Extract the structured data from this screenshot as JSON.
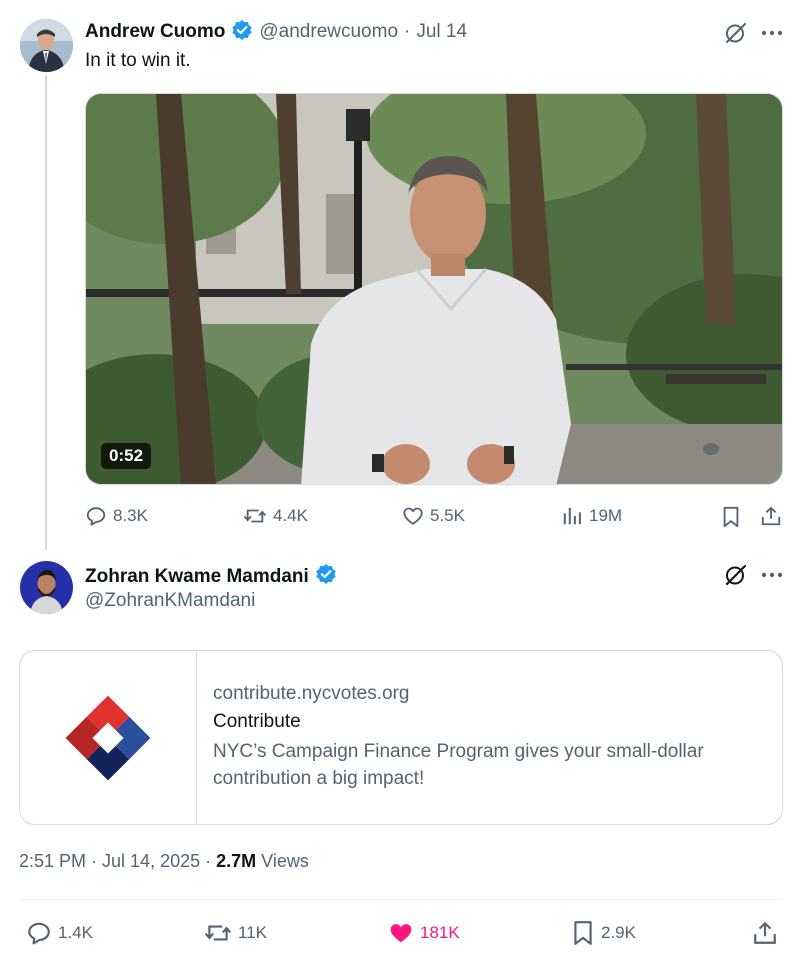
{
  "quoted_tweet": {
    "author_name": "Andrew Cuomo",
    "handle": "@andrewcuomo",
    "separator": "·",
    "date": "Jul 14",
    "text": "In it to win it.",
    "video_duration": "0:52",
    "stats": {
      "replies": "8.3K",
      "reposts": "4.4K",
      "likes": "5.5K",
      "views": "19M"
    }
  },
  "main_tweet": {
    "author_name": "Zohran Kwame Mamdani",
    "handle": "@ZohranKMamdani",
    "link_card": {
      "domain": "contribute.nycvotes.org",
      "title": "Contribute",
      "description": "NYC’s Campaign Finance Program gives your small-dollar contribution a big impact!"
    },
    "timestamp": "2:51 PM · Jul 14, 2025",
    "dot": "·",
    "views_count": "2.7M",
    "views_label": "Views",
    "stats": {
      "replies": "1.4K",
      "reposts": "11K",
      "likes": "181K",
      "bookmarks": "2.9K"
    }
  },
  "colors": {
    "verified": "#1d9bf0",
    "like_active": "#f91880",
    "muted_text": "#536471",
    "border": "#cfd9de"
  }
}
